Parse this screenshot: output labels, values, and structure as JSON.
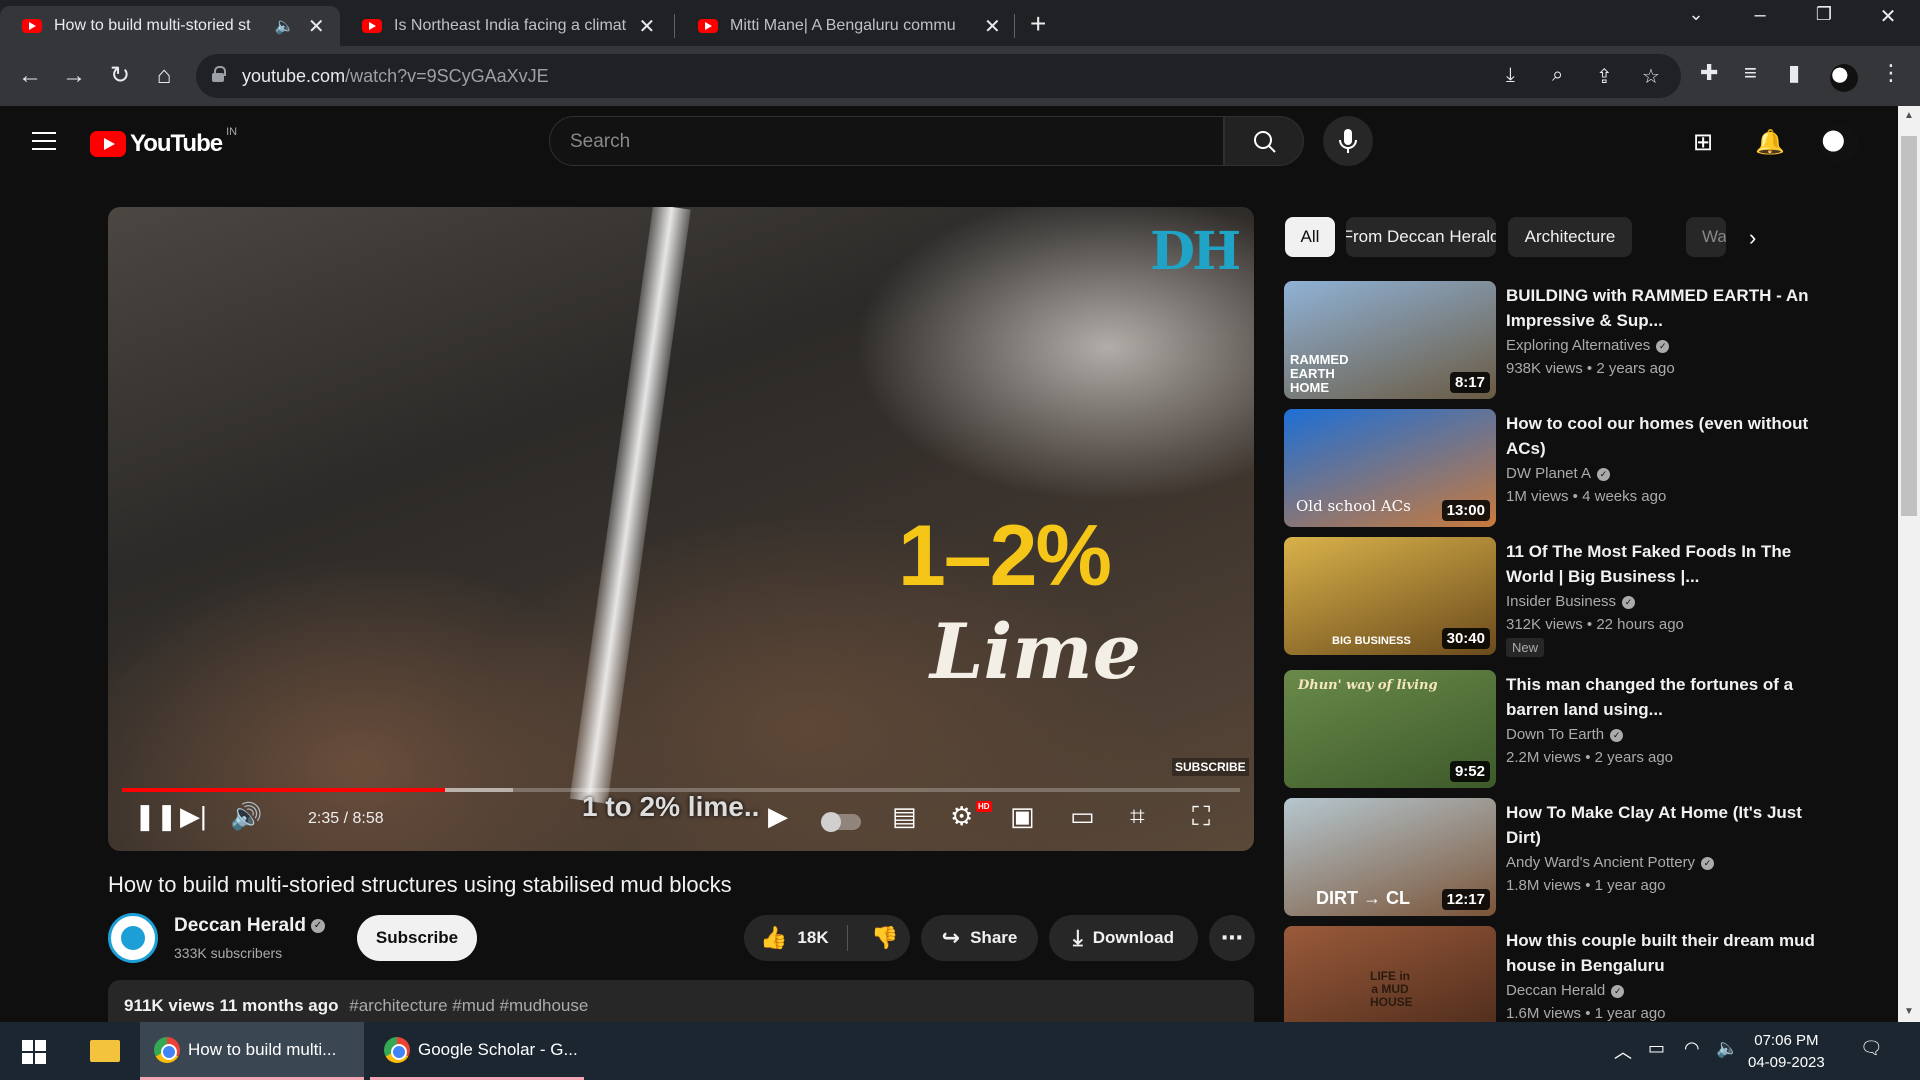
{
  "browser": {
    "tabs": [
      {
        "title": "How to build multi-storied st",
        "active": true,
        "audio": true
      },
      {
        "title": "Is Northeast India facing a climat",
        "active": false
      },
      {
        "title": "Mitti Mane| A Bengaluru commu",
        "active": false
      }
    ],
    "url_host": "youtube.com",
    "url_path": "/watch?v=9SCyGAaXvJE"
  },
  "header": {
    "logo_text": "YouTube",
    "country_code": "IN",
    "search_placeholder": "Search"
  },
  "player": {
    "overlay_percent": "1–2%",
    "overlay_word": "Lime",
    "watermark": "DH",
    "subscribe_watermark": "SUBSCRIBE",
    "caption": "1 to 2% lime..",
    "time": "2:35 / 8:58",
    "progress_played": 0.289,
    "progress_buffered": 0.35,
    "hd_badge": "HD"
  },
  "video": {
    "title": "How to build multi-storied structures using stabilised mud blocks",
    "channel": "Deccan Herald",
    "subscribers": "333K subscribers",
    "subscribe_label": "Subscribe",
    "likes": "18K",
    "share_label": "Share",
    "download_label": "Download",
    "views": "911K views",
    "age": "11 months ago",
    "tags": "#architecture #mud #mudhouse"
  },
  "chips": [
    "All",
    "From Deccan Herald",
    "Architecture",
    "Wa"
  ],
  "recommendations": [
    {
      "title": "BUILDING with RAMMED EARTH - An Impressive & Sup...",
      "channel": "Exploring Alternatives",
      "views": "938K views",
      "age": "2 years ago",
      "duration": "8:17",
      "thumb_text": "RAMMED EARTH HOME",
      "colors": [
        "#8fb2d6",
        "#6a5a42"
      ]
    },
    {
      "title": "How to cool our homes (even without ACs)",
      "channel": "DW Planet A",
      "views": "1M views",
      "age": "4 weeks ago",
      "duration": "13:00",
      "thumb_text": "Old school ACs",
      "colors": [
        "#1e6fd6",
        "#c97a3c"
      ]
    },
    {
      "title": "11 Of The Most Faked Foods In The World | Big Business |...",
      "channel": "Insider Business",
      "views": "312K views",
      "age": "22 hours ago",
      "duration": "30:40",
      "thumb_text": "BIG BUSINESS",
      "badge": "New",
      "colors": [
        "#d9b24a",
        "#6a4a1c"
      ]
    },
    {
      "title": "This man changed the fortunes of a barren land using...",
      "channel": "Down To Earth",
      "views": "2.2M views",
      "age": "2 years ago",
      "duration": "9:52",
      "thumb_text": "Dhun' way of living",
      "colors": [
        "#6a8a4a",
        "#3d5a2a"
      ]
    },
    {
      "title": "How To Make Clay At Home (It's Just Dirt)",
      "channel": "Andy Ward's Ancient Pottery",
      "views": "1.8M views",
      "age": "1 year ago",
      "duration": "12:17",
      "thumb_text": "DIRT → CL",
      "colors": [
        "#b5c7cf",
        "#7a5438"
      ]
    },
    {
      "title": "How this couple built their dream mud house in Bengaluru",
      "channel": "Deccan Herald",
      "views": "1.6M views",
      "age": "1 year ago",
      "duration": "",
      "thumb_text": "LIFE in a MUD HOUSE",
      "colors": [
        "#9a5a3a",
        "#4a2a1a"
      ]
    }
  ],
  "taskbar": {
    "apps": [
      {
        "label": "How to build multi...",
        "active": true
      },
      {
        "label": "Google Scholar - G...",
        "active": false
      }
    ],
    "time": "07:06 PM",
    "date": "04-09-2023"
  }
}
